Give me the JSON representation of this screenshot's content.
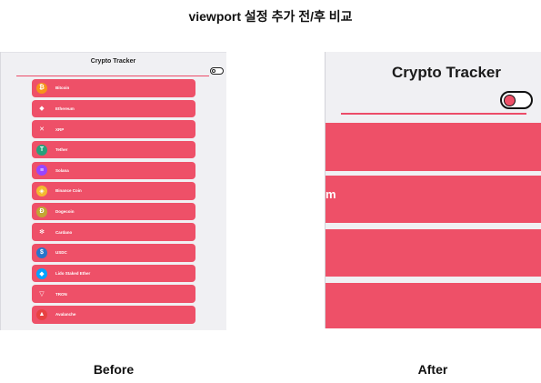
{
  "page_title": "viewport 설정 추가 전/후 비교",
  "before": {
    "caption": "Before",
    "app_title": "Crypto Tracker",
    "items": [
      {
        "label": "Bitcoin",
        "icon": "bitcoin-icon",
        "glyph": "₿",
        "color": "#f7931a"
      },
      {
        "label": "Ethereum",
        "icon": "ethereum-icon",
        "glyph": "◆",
        "color": "#ee5068"
      },
      {
        "label": "XRP",
        "icon": "xrp-icon",
        "glyph": "✕",
        "color": "#ee5068"
      },
      {
        "label": "Tether",
        "icon": "tether-icon",
        "glyph": "T",
        "color": "#26a17b"
      },
      {
        "label": "Solana",
        "icon": "solana-icon",
        "glyph": "≡",
        "color": "#9945ff"
      },
      {
        "label": "Binance Coin",
        "icon": "binance-icon",
        "glyph": "◈",
        "color": "#f3ba2f"
      },
      {
        "label": "Dogecoin",
        "icon": "dogecoin-icon",
        "glyph": "Ð",
        "color": "#c2a633"
      },
      {
        "label": "Cardano",
        "icon": "cardano-icon",
        "glyph": "✻",
        "color": "#ee5068"
      },
      {
        "label": "USDC",
        "icon": "usdc-icon",
        "glyph": "$",
        "color": "#2775ca"
      },
      {
        "label": "Lido Staked Ether",
        "icon": "lido-icon",
        "glyph": "◆",
        "color": "#00a3ff"
      },
      {
        "label": "TRON",
        "icon": "tron-icon",
        "glyph": "▽",
        "color": "#ee5068"
      },
      {
        "label": "Avalanche",
        "icon": "avalanche-icon",
        "glyph": "▲",
        "color": "#e84142"
      }
    ]
  },
  "after": {
    "caption": "After",
    "app_title": "Crypto Tracker",
    "visible_fragment": "m"
  },
  "colors": {
    "accent": "#ee5068",
    "panel_bg": "#f0f0f3"
  }
}
